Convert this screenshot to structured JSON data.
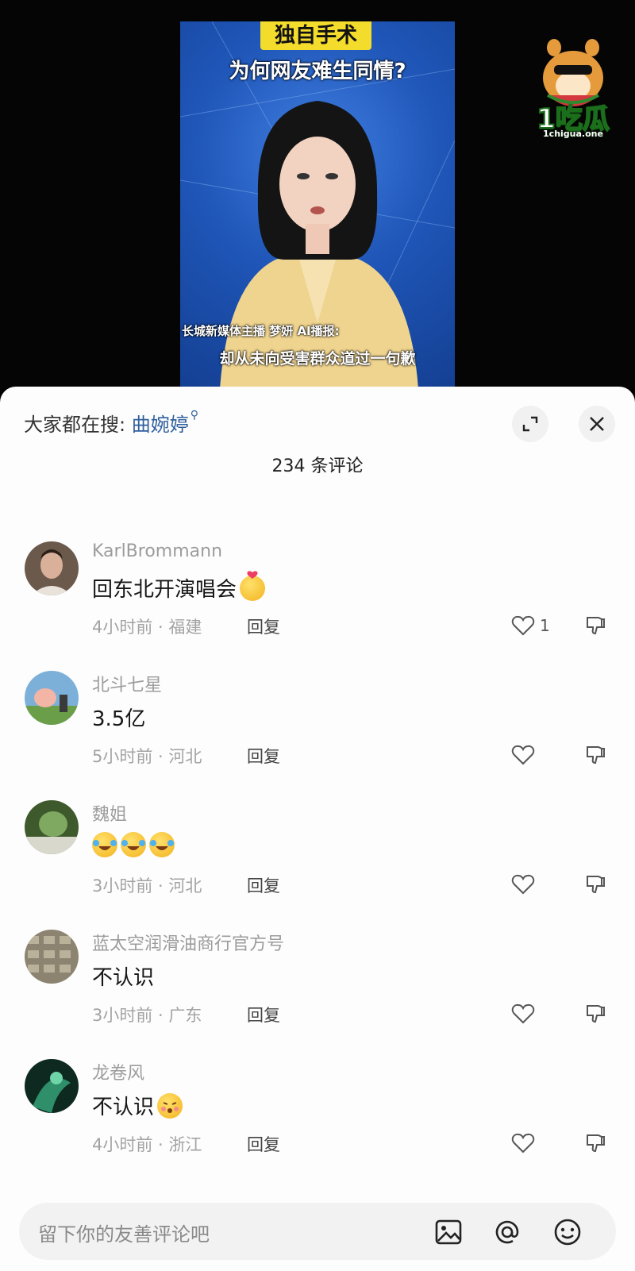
{
  "video": {
    "title_tag": "独自手术",
    "title_line2": "为何网友难生同情?",
    "subtitle_line1": "长城新媒体主播 梦妍 AI播报:",
    "subtitle_line2": "却从未向受害群众道过一句歉",
    "logo_text": "1吃瓜",
    "logo_url": "1chigua.one"
  },
  "comments_panel": {
    "hot_search_label": "大家都在搜:",
    "hot_search_term": "曲婉婷",
    "count_title": "234 条评论",
    "reply_label": "回复",
    "comments": [
      {
        "username": "KarlBrommann",
        "text": "回东北开演唱会",
        "emoji": "finger-heart-emoji",
        "meta": "4小时前 · 福建",
        "likes": "1"
      },
      {
        "username": "北斗七星",
        "text": "3.5亿",
        "emoji": "",
        "meta": "5小时前 · 河北",
        "likes": ""
      },
      {
        "username": "魏姐",
        "text": "",
        "emoji": "laughing-crying-emoji-x3",
        "meta": "3小时前 · 河北",
        "likes": ""
      },
      {
        "username": "蓝太空润滑油商行官方号",
        "text": "不认识",
        "emoji": "",
        "meta": "3小时前 · 广东",
        "likes": ""
      },
      {
        "username": "龙卷风",
        "text": "不认识",
        "emoji": "kissing-emoji",
        "meta": "4小时前 · 浙江",
        "likes": ""
      }
    ]
  },
  "input": {
    "placeholder": "留下你的友善评论吧"
  },
  "colors": {
    "link_blue": "#2f5f9e",
    "title_yellow": "#f4dc2c",
    "video_blue": "#1f56b8"
  }
}
